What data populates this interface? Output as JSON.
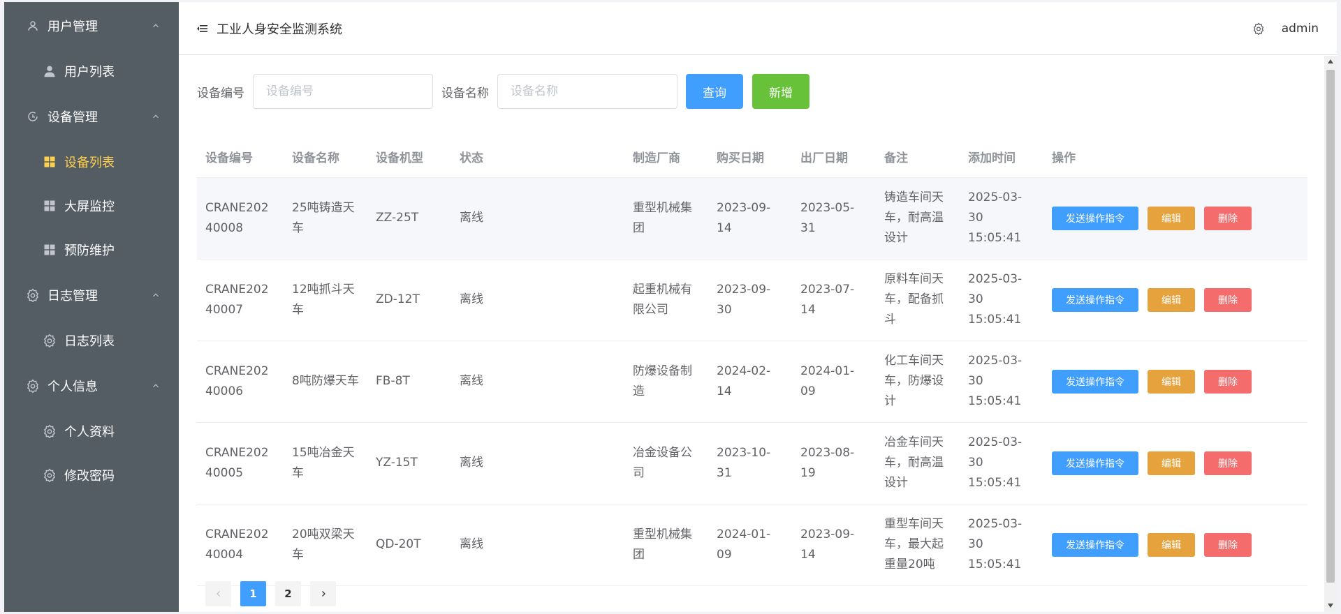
{
  "sidebar": {
    "groups": [
      {
        "label": "用户管理",
        "icon": "user-icon",
        "items": [
          {
            "label": "用户列表",
            "icon": "person-icon"
          }
        ]
      },
      {
        "label": "设备管理",
        "icon": "refresh-icon",
        "items": [
          {
            "label": "设备列表",
            "icon": "grid-icon",
            "active": true
          },
          {
            "label": "大屏监控",
            "icon": "grid-icon"
          },
          {
            "label": "预防维护",
            "icon": "grid-icon"
          }
        ]
      },
      {
        "label": "日志管理",
        "icon": "gear-icon",
        "items": [
          {
            "label": "日志列表",
            "icon": "gear-icon"
          }
        ]
      },
      {
        "label": "个人信息",
        "icon": "gear-icon",
        "items": [
          {
            "label": "个人资料",
            "icon": "gear-icon"
          },
          {
            "label": "修改密码",
            "icon": "gear-icon"
          }
        ]
      }
    ]
  },
  "header": {
    "title": "工业人身安全监测系统",
    "user": "admin"
  },
  "search": {
    "code_label": "设备编号",
    "code_placeholder": "设备编号",
    "name_label": "设备名称",
    "name_placeholder": "设备名称",
    "query_button": "查询",
    "add_button": "新增"
  },
  "table": {
    "columns": [
      "设备编号",
      "设备名称",
      "设备机型",
      "状态",
      "制造厂商",
      "购买日期",
      "出厂日期",
      "备注",
      "添加时间",
      "操作"
    ],
    "rows": [
      {
        "code": "CRANE20240008",
        "name": "25吨铸造天车",
        "model": "ZZ-25T",
        "status": "离线",
        "maker": "重型机械集团",
        "buy": "2023-09-14",
        "factory": "2023-05-31",
        "note": "铸造车间天车，耐高温设计",
        "added": "2025-03-30 15:05:41"
      },
      {
        "code": "CRANE20240007",
        "name": "12吨抓斗天车",
        "model": "ZD-12T",
        "status": "离线",
        "maker": "起重机械有限公司",
        "buy": "2023-09-30",
        "factory": "2023-07-14",
        "note": "原料车间天车，配备抓斗",
        "added": "2025-03-30 15:05:41"
      },
      {
        "code": "CRANE20240006",
        "name": "8吨防爆天车",
        "model": "FB-8T",
        "status": "离线",
        "maker": "防爆设备制造",
        "buy": "2024-02-14",
        "factory": "2024-01-09",
        "note": "化工车间天车，防爆设计",
        "added": "2025-03-30 15:05:41"
      },
      {
        "code": "CRANE20240005",
        "name": "15吨冶金天车",
        "model": "YZ-15T",
        "status": "离线",
        "maker": "冶金设备公司",
        "buy": "2023-10-31",
        "factory": "2023-08-19",
        "note": "冶金车间天车，耐高温设计",
        "added": "2025-03-30 15:05:41"
      },
      {
        "code": "CRANE20240004",
        "name": "20吨双梁天车",
        "model": "QD-20T",
        "status": "离线",
        "maker": "重型机械集团",
        "buy": "2024-01-09",
        "factory": "2023-09-14",
        "note": "重型车间天车，最大起重量20吨",
        "added": "2025-03-30 15:05:41"
      }
    ],
    "actions": {
      "send": "发送操作指令",
      "edit": "编辑",
      "delete": "删除"
    }
  },
  "pagination": {
    "pages": [
      "1",
      "2"
    ],
    "current": "1"
  },
  "colors": {
    "sidebar_bg": "#545c64",
    "active": "#ffd04b",
    "primary": "#409eff",
    "success": "#67c23a",
    "warning": "#e6a23c",
    "danger": "#f56c6c"
  }
}
